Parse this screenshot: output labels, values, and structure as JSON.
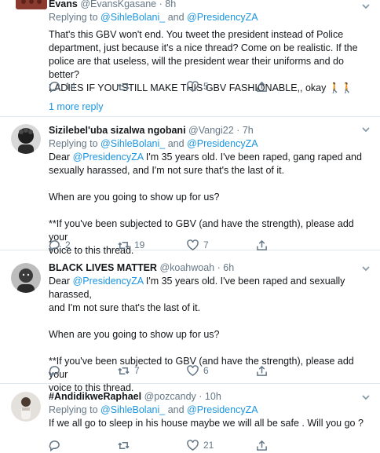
{
  "tweets": [
    {
      "name": "Evans",
      "handle": "@EvansKgasane",
      "dot": "·",
      "time": "8h",
      "replying_prefix": "Replying to",
      "replying_mentions": [
        "@SihleBolani_",
        "@PresidencyZA"
      ],
      "replying_and": "and",
      "lines": [
        "That's this GBV won't end. You tweet the president instead of Police",
        "department, just because it's a nice thread? Come on be realistic. If the",
        "police are that useless, will the president wear their uniforms and do better?",
        "LADIES IF YOU STILL MAKE THIS GBV FASHIONABLE,, okay 🚶🚶"
      ],
      "replies": "14",
      "retweets": "",
      "likes": "5",
      "more_replies": "1 more reply",
      "avatar_color": "#8a3a2e"
    },
    {
      "name": "Sizilebel'uba sizalwa ngobani",
      "handle": "@Vangi22",
      "dot": "·",
      "time": "7h",
      "replying_prefix": "Replying to",
      "replying_mentions": [
        "@SihleBolani_",
        "@PresidencyZA"
      ],
      "replying_and": "and",
      "lines_intro": "Dear ",
      "lines_intro_mention": "@PresidencyZA",
      "lines_first_rest": " I'm 35 years old. I've been raped, gang raped and",
      "lines": [
        "sexually harassed, and I'm not sure that's the last of it.",
        "",
        "When are you going to show up for us?",
        "",
        "**If you've been subjected to GBV (and have the strength), please add your",
        "voice to this thread."
      ],
      "replies": "2",
      "retweets": "19",
      "likes": "7",
      "avatar_color": "#2b2b2b"
    },
    {
      "name": "BLACK LIVES MATTER",
      "handle": "@koahwoah",
      "dot": "·",
      "time": "6h",
      "lines_intro": "Dear ",
      "lines_intro_mention": "@PresidencyZA",
      "lines_first_rest": " I'm 35 years old. I've been raped and sexually harassed,",
      "lines": [
        "and I'm not sure that's the last of it.",
        "",
        "When are you going to show up for us?",
        "",
        "**If you've been subjected to GBV (and have the strength), please add your",
        "voice to this thread."
      ],
      "replies": "",
      "retweets": "7",
      "likes": "6",
      "avatar_color": "#3a3a3a"
    },
    {
      "name": "#AndidikweRaphael",
      "handle": "@pozcandy",
      "dot": "·",
      "time": "10h",
      "replying_prefix": "Replying to",
      "replying_mentions": [
        "@SihleBolani_",
        "@PresidencyZA"
      ],
      "replying_and": "and",
      "lines": [
        "If we all go to sleep in his house maybe we will all  be safe . Will you go ?"
      ],
      "replies": "",
      "retweets": "",
      "likes": "21",
      "avatar_color": "#d9d4cf"
    }
  ],
  "icons": {
    "reply": "reply-icon",
    "retweet": "retweet-icon",
    "like": "like-icon",
    "more": "chevron-down-icon"
  },
  "colors": {
    "link": "#1b95e0",
    "secondary": "#657786",
    "divider": "#e1e8ed"
  }
}
